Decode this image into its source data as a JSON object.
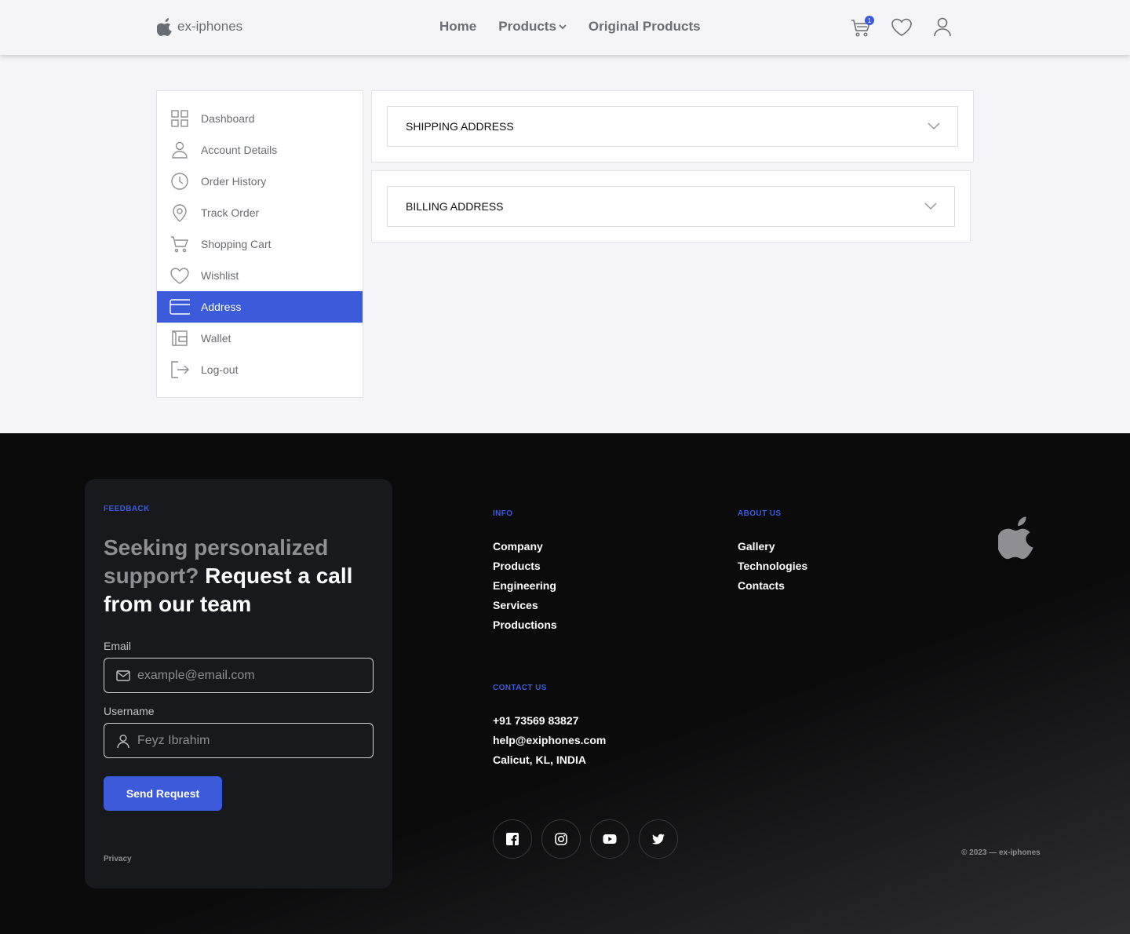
{
  "brand": {
    "name": "ex-iphones"
  },
  "nav": {
    "home": "Home",
    "products": "Products",
    "original_products": "Original Products"
  },
  "header_icons": {
    "cart_count": "1",
    "cart_icon": "cart-icon",
    "wishlist_icon": "heart-icon",
    "account_icon": "user-icon"
  },
  "sidebar": {
    "items": [
      {
        "label": "Dashboard",
        "icon": "grid-icon"
      },
      {
        "label": "Account Details",
        "icon": "user-icon"
      },
      {
        "label": "Order History",
        "icon": "clock-icon"
      },
      {
        "label": "Track Order",
        "icon": "location-pin-icon"
      },
      {
        "label": "Shopping Cart",
        "icon": "cart-icon"
      },
      {
        "label": "Wishlist",
        "icon": "heart-icon"
      },
      {
        "label": "Address",
        "icon": "card-icon",
        "active": true
      },
      {
        "label": "Wallet",
        "icon": "wallet-icon"
      },
      {
        "label": "Log-out",
        "icon": "logout-icon"
      }
    ]
  },
  "address": {
    "shipping": "SHIPPING ADDRESS",
    "billing": "BILLING ADDRESS"
  },
  "feedback": {
    "eyebrow": "FEEDBACK",
    "heading_muted": "Seeking personalized support?",
    "heading_bold": "Request a call from our team",
    "email_label": "Email",
    "email_placeholder": "example@email.com",
    "username_label": "Username",
    "username_placeholder": "Feyz Ibrahim",
    "send_label": "Send Request",
    "privacy": "Privacy"
  },
  "footer": {
    "info_title": "INFO",
    "info_links": [
      "Company",
      "Products",
      "Engineering",
      "Services",
      "Productions"
    ],
    "about_title": "ABOUT US",
    "about_links": [
      "Gallery",
      "Technologies",
      "Contacts"
    ],
    "contact_title": "CONTACT US",
    "contact_lines": [
      "+91 73569 83827",
      "help@exiphones.com",
      "Calicut, KL, INDIA"
    ],
    "socials": [
      "facebook-icon",
      "instagram-icon",
      "youtube-icon",
      "twitter-icon"
    ],
    "copyright": "© 2023 — ex-iphones"
  },
  "colors": {
    "accent": "#3b5bdb",
    "page_bg": "#f5f5f7",
    "footer_bg": "#0b0b0c",
    "card_bg": "#18191d"
  }
}
